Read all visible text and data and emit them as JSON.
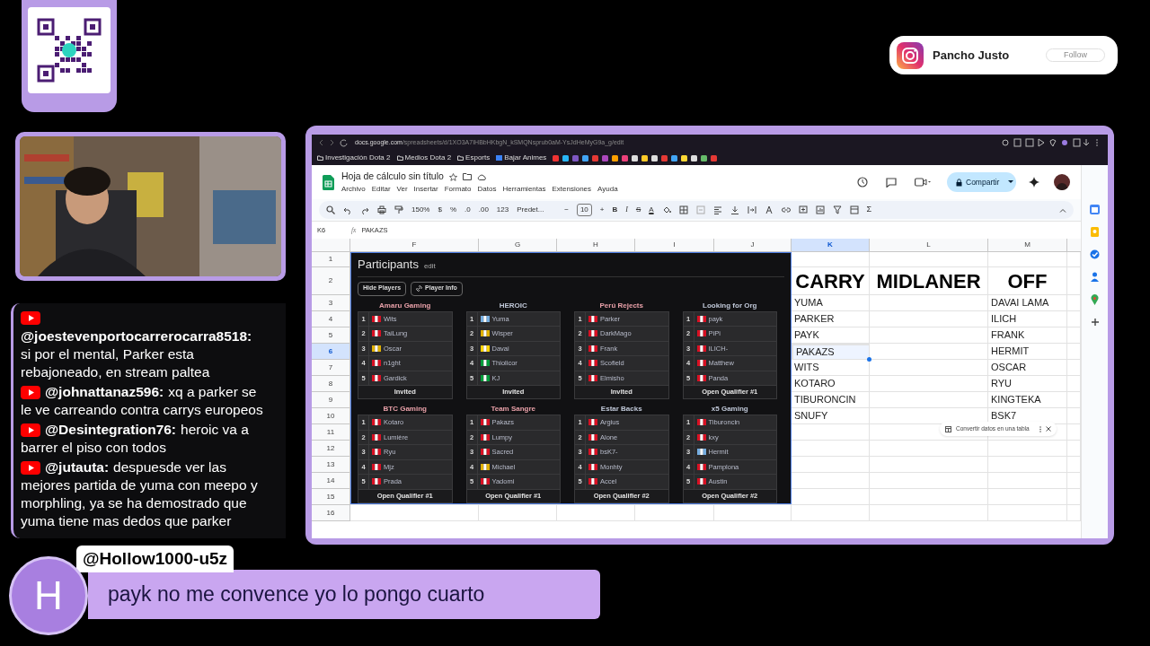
{
  "instagram": {
    "name": "Pancho Justo",
    "button": "Follow"
  },
  "chat": {
    "messages": [
      {
        "author": "@joestevenportocarrerocarra8518:",
        "lines": [
          "si por el mental, Parker esta",
          "rebajoneado, en stream paltea"
        ]
      },
      {
        "author": "@johnattanaz596:",
        "inline": "xq a parker se",
        "lines": [
          "le ve carreando contra carrys europeos"
        ]
      },
      {
        "author": "@Desintegration76:",
        "inline": "heroic va a",
        "lines": [
          "barrer el piso con todos"
        ]
      },
      {
        "author": "@jutauta:",
        "inline": "despuesde ver las",
        "lines": [
          "mejores partida de yuma con meepo y",
          "morphling, ya se ha demostrado que",
          "yuma tiene mas dedos que parker"
        ]
      }
    ]
  },
  "highlighted_message": {
    "avatar_letter": "H",
    "author": "@Hollow1000-u5z",
    "text": "payk no me convence yo lo pongo cuarto"
  },
  "browser": {
    "url_host": "docs.google.com",
    "url_path": "/spreadsheets/d/1XO3A7IHBbHKbgN_kSMQNsprub0aM-YsJdHeMyG9a_g/edit",
    "bookmarks": [
      "Investigación Dota 2",
      "Medios Dota 2",
      "Esports",
      "Bajar Animes"
    ]
  },
  "sheet": {
    "title": "Hoja de cálculo sin título",
    "menus": [
      "Archivo",
      "Editar",
      "Ver",
      "Insertar",
      "Formato",
      "Datos",
      "Herramientas",
      "Extensiones",
      "Ayuda"
    ],
    "share": "Compartir",
    "zoom": "150%",
    "number_formats": [
      "$",
      "%",
      ".0",
      ".00",
      "123"
    ],
    "font": "Predet...",
    "font_size": "10",
    "size_buttons": [
      "−",
      "+"
    ],
    "text_styles": [
      "B",
      "I",
      "S",
      "A"
    ],
    "sum": "Σ",
    "cell_ref": "K6",
    "fx": "fx",
    "formula": "PAKAZS",
    "columns": [
      {
        "label": "F",
        "selected": false
      },
      {
        "label": "G",
        "selected": false
      },
      {
        "label": "H",
        "selected": false
      },
      {
        "label": "I",
        "selected": false
      },
      {
        "label": "J",
        "selected": false
      },
      {
        "label": "K",
        "selected": true
      },
      {
        "label": "L",
        "selected": false
      },
      {
        "label": "M",
        "selected": false
      }
    ],
    "rows": [
      {
        "label": "1",
        "selected": false
      },
      {
        "label": "2",
        "selected": false
      },
      {
        "label": "3",
        "selected": false
      },
      {
        "label": "4",
        "selected": false
      },
      {
        "label": "5",
        "selected": false
      },
      {
        "label": "6",
        "selected": true
      },
      {
        "label": "7",
        "selected": false
      },
      {
        "label": "8",
        "selected": false
      },
      {
        "label": "9",
        "selected": false
      },
      {
        "label": "10",
        "selected": false
      },
      {
        "label": "11",
        "selected": false
      },
      {
        "label": "12",
        "selected": false
      },
      {
        "label": "13",
        "selected": false
      },
      {
        "label": "14",
        "selected": false
      },
      {
        "label": "15",
        "selected": false
      },
      {
        "label": "16",
        "selected": false
      }
    ],
    "role_columns": [
      {
        "header": "CARRY",
        "cells": [
          {
            "text": "YUMA",
            "selected": false
          },
          {
            "text": "PARKER",
            "selected": false
          },
          {
            "text": "PAYK",
            "selected": false
          },
          {
            "text": "PAKAZS",
            "selected": true
          },
          {
            "text": "WITS",
            "selected": false
          },
          {
            "text": "KOTARO",
            "selected": false
          },
          {
            "text": "TIBURONCIN",
            "selected": false
          },
          {
            "text": "SNUFY",
            "selected": false
          }
        ]
      },
      {
        "header": "MIDLANER"
      },
      {
        "header": "OFF",
        "cells": [
          {
            "text": "DAVAI LAMA",
            "selected": false
          },
          {
            "text": "ILICH",
            "selected": false
          },
          {
            "text": "FRANK",
            "selected": false
          },
          {
            "text": "HERMIT",
            "selected": false
          },
          {
            "text": "OSCAR",
            "selected": false
          },
          {
            "text": "RYU",
            "selected": false
          },
          {
            "text": "KINGTEKA",
            "selected": false
          },
          {
            "text": "BSK7",
            "selected": false
          }
        ]
      }
    ],
    "toast": "Convertir datos en una tabla"
  },
  "participants": {
    "title": "Participants",
    "edit": "edit",
    "buttons": [
      "Hide Players",
      "Player Info"
    ],
    "teams": [
      {
        "name": "Amaru Gaming",
        "color": "#e8a0a8",
        "footer": "Invited",
        "players": [
          {
            "number": "1",
            "name": "Wits",
            "color": "#d91023"
          },
          {
            "number": "2",
            "name": "TaiLung",
            "color": "#d91023"
          },
          {
            "number": "3",
            "name": "Oscar",
            "color": "#e0b000"
          },
          {
            "number": "4",
            "name": "n1ght",
            "color": "#d91023"
          },
          {
            "number": "5",
            "name": "Gardick",
            "color": "#d91023"
          }
        ]
      },
      {
        "name": "HEROIC",
        "color": "#c0c8d8",
        "footer": "Invited",
        "players": [
          {
            "number": "1",
            "name": "Yuma",
            "color": "#74acdf"
          },
          {
            "number": "2",
            "name": "Wisper",
            "color": "#e0b000"
          },
          {
            "number": "3",
            "name": "Davai",
            "color": "#ffd200"
          },
          {
            "number": "4",
            "name": "Thiolicor",
            "color": "#009c3b"
          },
          {
            "number": "5",
            "name": "KJ",
            "color": "#009c3b"
          }
        ]
      },
      {
        "name": "Perú Rejects",
        "color": "#e8a0a8",
        "footer": "Invited",
        "players": [
          {
            "number": "1",
            "name": "Parker",
            "color": "#d91023"
          },
          {
            "number": "2",
            "name": "DarkMago",
            "color": "#d91023"
          },
          {
            "number": "3",
            "name": "Frank",
            "color": "#d91023"
          },
          {
            "number": "4",
            "name": "Scofield",
            "color": "#d91023"
          },
          {
            "number": "5",
            "name": "Elmisho",
            "color": "#d91023"
          }
        ]
      },
      {
        "name": "Looking for Org",
        "color": "#c0c8d8",
        "footer": "Open Qualifier #1",
        "players": [
          {
            "number": "1",
            "name": "payk",
            "color": "#d91023"
          },
          {
            "number": "2",
            "name": "PiPi",
            "color": "#d91023"
          },
          {
            "number": "3",
            "name": "ILICH-",
            "color": "#d91023"
          },
          {
            "number": "4",
            "name": "Matthew",
            "color": "#d91023"
          },
          {
            "number": "5",
            "name": "Panda",
            "color": "#d91023"
          }
        ]
      },
      {
        "name": "BTC Gaming",
        "color": "#e8a0a8",
        "footer": "Open Qualifier #1",
        "players": [
          {
            "number": "1",
            "name": "Kotaro",
            "color": "#d91023"
          },
          {
            "number": "2",
            "name": "Lumière",
            "color": "#d91023"
          },
          {
            "number": "3",
            "name": "Ryu",
            "color": "#d91023"
          },
          {
            "number": "4",
            "name": "Mjz",
            "color": "#d91023"
          },
          {
            "number": "5",
            "name": "Prada",
            "color": "#d91023"
          }
        ]
      },
      {
        "name": "Team Sangre",
        "color": "#e8a0a8",
        "footer": "Open Qualifier #1",
        "players": [
          {
            "number": "1",
            "name": "Pakazs",
            "color": "#d91023"
          },
          {
            "number": "2",
            "name": "Lumpy",
            "color": "#d91023"
          },
          {
            "number": "3",
            "name": "Sacred",
            "color": "#d91023"
          },
          {
            "number": "4",
            "name": "Michael",
            "color": "#e0b000"
          },
          {
            "number": "5",
            "name": "Yadomi",
            "color": "#d91023"
          }
        ]
      },
      {
        "name": "Estar Backs",
        "color": "#c0c8d8",
        "footer": "Open Qualifier #2",
        "players": [
          {
            "number": "1",
            "name": "Argius",
            "color": "#d91023"
          },
          {
            "number": "2",
            "name": "Alone",
            "color": "#d91023"
          },
          {
            "number": "3",
            "name": "bsK7-",
            "color": "#d91023"
          },
          {
            "number": "4",
            "name": "Monhty",
            "color": "#d91023"
          },
          {
            "number": "5",
            "name": "Accel",
            "color": "#d91023"
          }
        ]
      },
      {
        "name": "x5 Gaming",
        "color": "#c0c8d8",
        "footer": "Open Qualifier #2",
        "players": [
          {
            "number": "1",
            "name": "Tiburoncin",
            "color": "#d91023"
          },
          {
            "number": "2",
            "name": "kxy",
            "color": "#d91023"
          },
          {
            "number": "3",
            "name": "Hermit",
            "color": "#74acdf"
          },
          {
            "number": "4",
            "name": "Pamplona",
            "color": "#d91023"
          },
          {
            "number": "5",
            "name": "Austin",
            "color": "#d91023"
          }
        ]
      }
    ]
  }
}
